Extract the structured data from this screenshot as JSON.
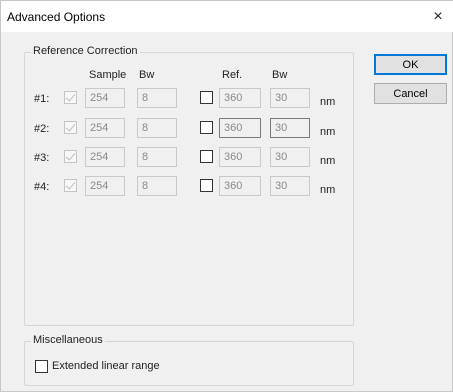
{
  "dialog": {
    "title": "Advanced Options",
    "close_label": "×"
  },
  "reference_group": {
    "legend": "Reference Correction",
    "headers": {
      "sample": "Sample",
      "bw1": "Bw",
      "ref": "Ref.",
      "bw2": "Bw"
    },
    "rows": [
      {
        "label": "#1:",
        "sample": "254",
        "bw": "8",
        "ref": "360",
        "ref_bw": "30",
        "unit": "nm"
      },
      {
        "label": "#2:",
        "sample": "254",
        "bw": "8",
        "ref": "360",
        "ref_bw": "30",
        "unit": "nm"
      },
      {
        "label": "#3:",
        "sample": "254",
        "bw": "8",
        "ref": "360",
        "ref_bw": "30",
        "unit": "nm"
      },
      {
        "label": "#4:",
        "sample": "254",
        "bw": "8",
        "ref": "360",
        "ref_bw": "30",
        "unit": "nm"
      }
    ]
  },
  "misc_group": {
    "legend": "Miscellaneous",
    "extended_label": "Extended linear range"
  },
  "buttons": {
    "ok": "OK",
    "cancel": "Cancel"
  }
}
